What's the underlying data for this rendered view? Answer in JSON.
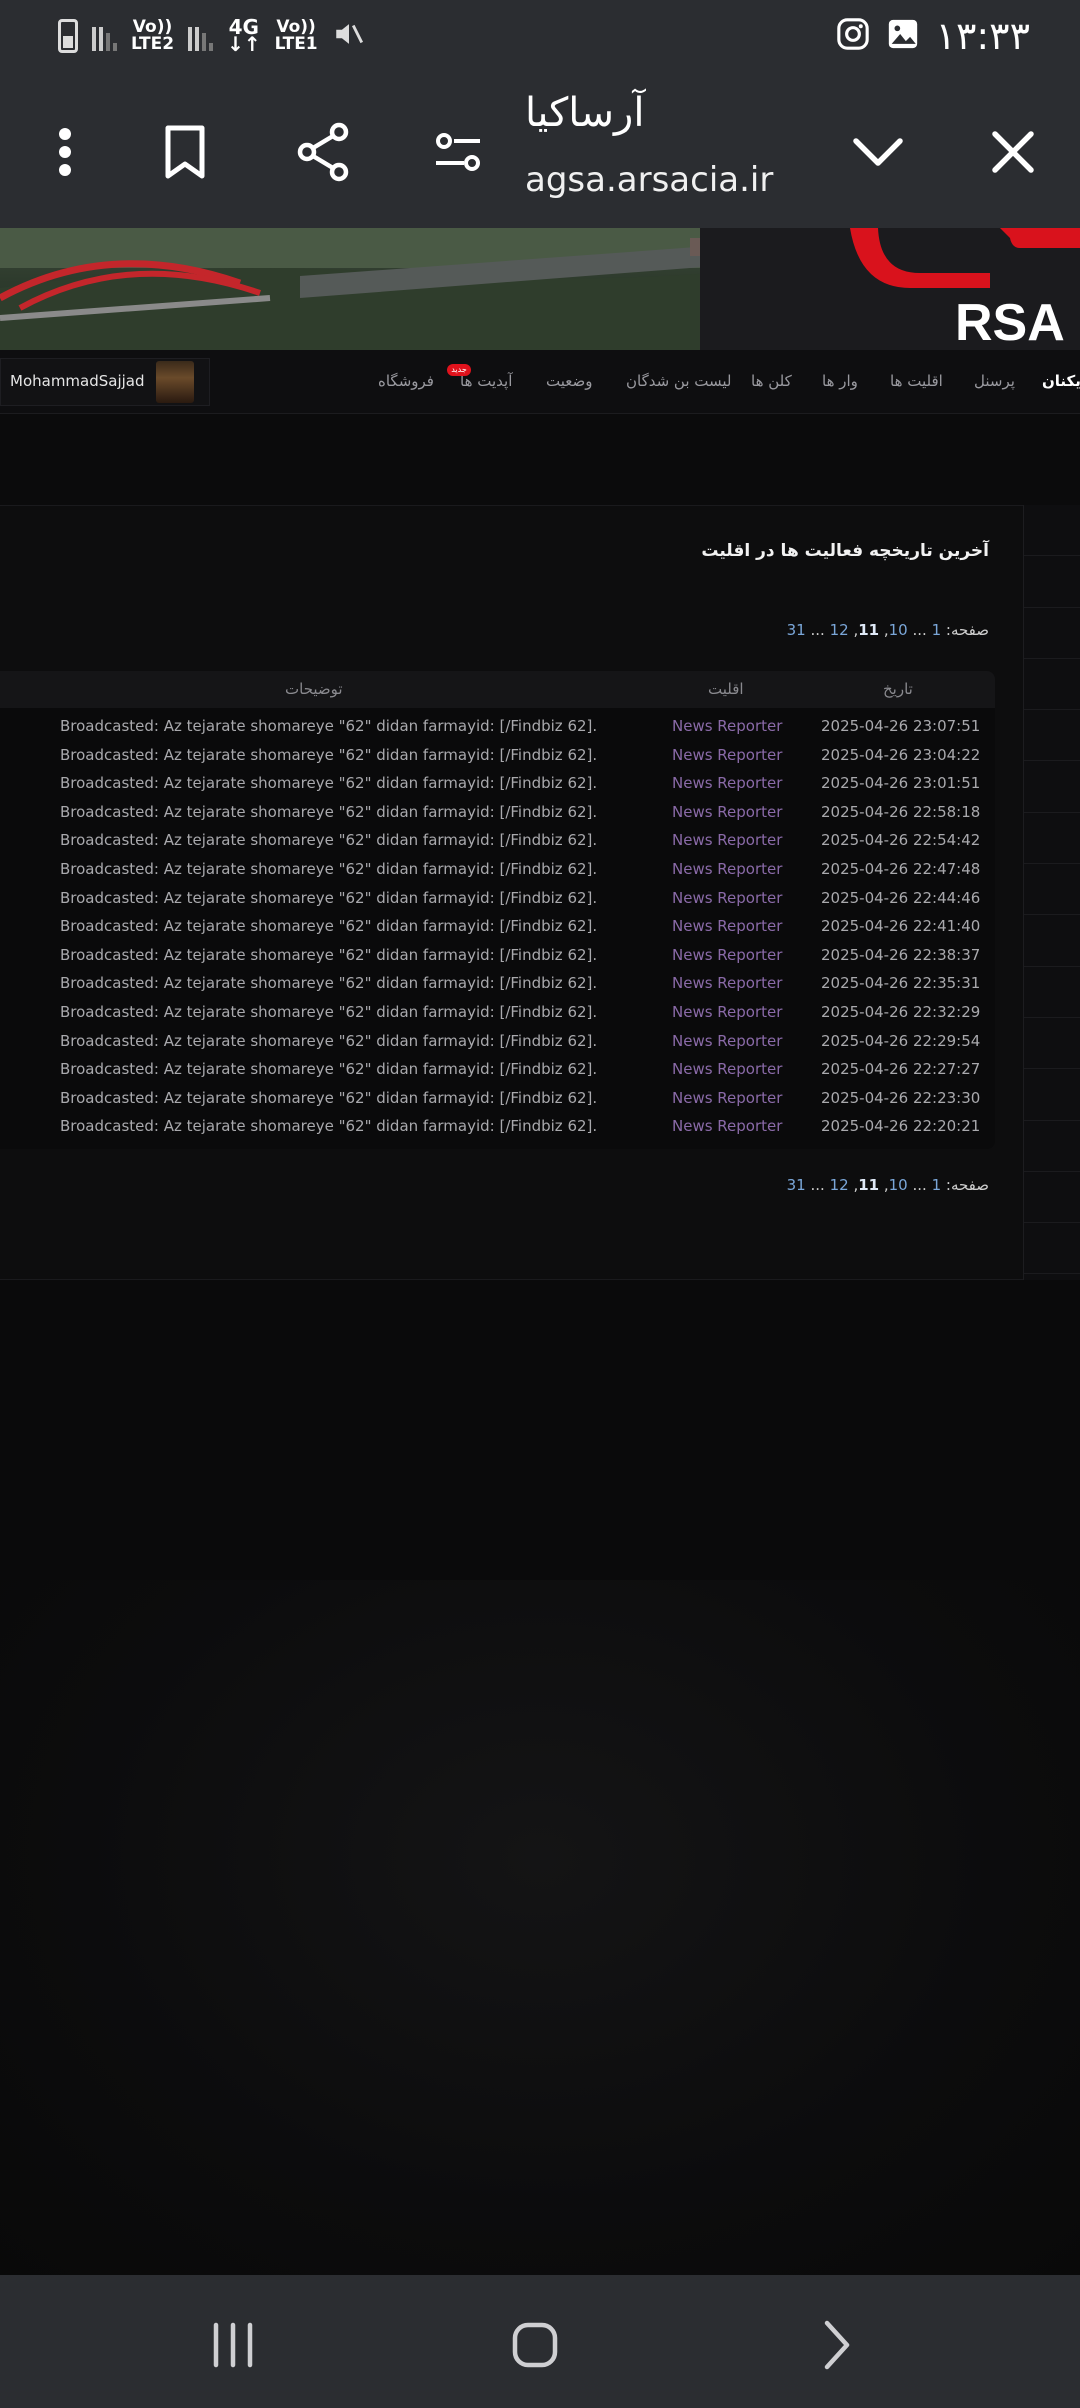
{
  "status_bar": {
    "time": "۱۳:۳۳",
    "net1": [
      "Vo))",
      "LTE2"
    ],
    "net2": [
      "4G",
      "↓↑"
    ],
    "net3": [
      "Vo))",
      "LTE1"
    ]
  },
  "app_bar": {
    "title": "آرساکیا",
    "url": "agsa.arsacia.ir"
  },
  "nav": {
    "items": [
      "پرسنل",
      "اقلیت ها",
      "وار ها",
      "کلن ها",
      "لیست بن شدگان",
      "وضعیت",
      "آپدیت ها",
      "فروشگاه"
    ],
    "partial": "ازیکنان",
    "badge": "جدید",
    "username": "MohammadSajjad"
  },
  "page": {
    "heading": "آخرین تاریخچه فعالیت ها در اقلیت",
    "pager_label": "صفحه: ",
    "pager_1": "1",
    "pager_dots1": " ... ",
    "pager_10": "10",
    "pager_11": "11",
    "pager_12": "12",
    "pager_dots2": " ... ",
    "pager_31": "31"
  },
  "table": {
    "headers": {
      "date": "تاریخ",
      "faction": "اقلیت",
      "desc": "توضیحات"
    },
    "rows": [
      {
        "desc": "Broadcasted: Az tejarate shomareye \"62\" didan farmayid: [/Findbiz 62].",
        "faction": "News Reporter",
        "date": "2025-04-26 23:07:51"
      },
      {
        "desc": "Broadcasted: Az tejarate shomareye \"62\" didan farmayid: [/Findbiz 62].",
        "faction": "News Reporter",
        "date": "2025-04-26 23:04:22"
      },
      {
        "desc": "Broadcasted: Az tejarate shomareye \"62\" didan farmayid: [/Findbiz 62].",
        "faction": "News Reporter",
        "date": "2025-04-26 23:01:51"
      },
      {
        "desc": "Broadcasted: Az tejarate shomareye \"62\" didan farmayid: [/Findbiz 62].",
        "faction": "News Reporter",
        "date": "2025-04-26 22:58:18"
      },
      {
        "desc": "Broadcasted: Az tejarate shomareye \"62\" didan farmayid: [/Findbiz 62].",
        "faction": "News Reporter",
        "date": "2025-04-26 22:54:42"
      },
      {
        "desc": "Broadcasted: Az tejarate shomareye \"62\" didan farmayid: [/Findbiz 62].",
        "faction": "News Reporter",
        "date": "2025-04-26 22:47:48"
      },
      {
        "desc": "Broadcasted: Az tejarate shomareye \"62\" didan farmayid: [/Findbiz 62].",
        "faction": "News Reporter",
        "date": "2025-04-26 22:44:46"
      },
      {
        "desc": "Broadcasted: Az tejarate shomareye \"62\" didan farmayid: [/Findbiz 62].",
        "faction": "News Reporter",
        "date": "2025-04-26 22:41:40"
      },
      {
        "desc": "Broadcasted: Az tejarate shomareye \"62\" didan farmayid: [/Findbiz 62].",
        "faction": "News Reporter",
        "date": "2025-04-26 22:38:37"
      },
      {
        "desc": "Broadcasted: Az tejarate shomareye \"62\" didan farmayid: [/Findbiz 62].",
        "faction": "News Reporter",
        "date": "2025-04-26 22:35:31"
      },
      {
        "desc": "Broadcasted: Az tejarate shomareye \"62\" didan farmayid: [/Findbiz 62].",
        "faction": "News Reporter",
        "date": "2025-04-26 22:32:29"
      },
      {
        "desc": "Broadcasted: Az tejarate shomareye \"62\" didan farmayid: [/Findbiz 62].",
        "faction": "News Reporter",
        "date": "2025-04-26 22:29:54"
      },
      {
        "desc": "Broadcasted: Az tejarate shomareye \"62\" didan farmayid: [/Findbiz 62].",
        "faction": "News Reporter",
        "date": "2025-04-26 22:27:27"
      },
      {
        "desc": "Broadcasted: Az tejarate shomareye \"62\" didan farmayid: [/Findbiz 62].",
        "faction": "News Reporter",
        "date": "2025-04-26 22:23:30"
      },
      {
        "desc": "Broadcasted: Az tejarate shomareye \"62\" didan farmayid: [/Findbiz 62].",
        "faction": "News Reporter",
        "date": "2025-04-26 22:20:21"
      }
    ]
  },
  "colors": {
    "chrome": "#2b2d31",
    "background": "#0b0b0c",
    "faction_link": "#8a6aa8",
    "pager_link": "#7aa6d8",
    "badge": "#e0121c"
  },
  "icons": {
    "app_bar": [
      "more-vert-icon",
      "bookmark-icon",
      "share-icon",
      "tune-icon",
      "chevron-down-icon",
      "close-icon"
    ],
    "status": [
      "instagram-icon",
      "gallery-icon",
      "mute-icon",
      "battery-icon"
    ],
    "system_nav": [
      "recents-icon",
      "home-icon",
      "back-icon"
    ]
  }
}
